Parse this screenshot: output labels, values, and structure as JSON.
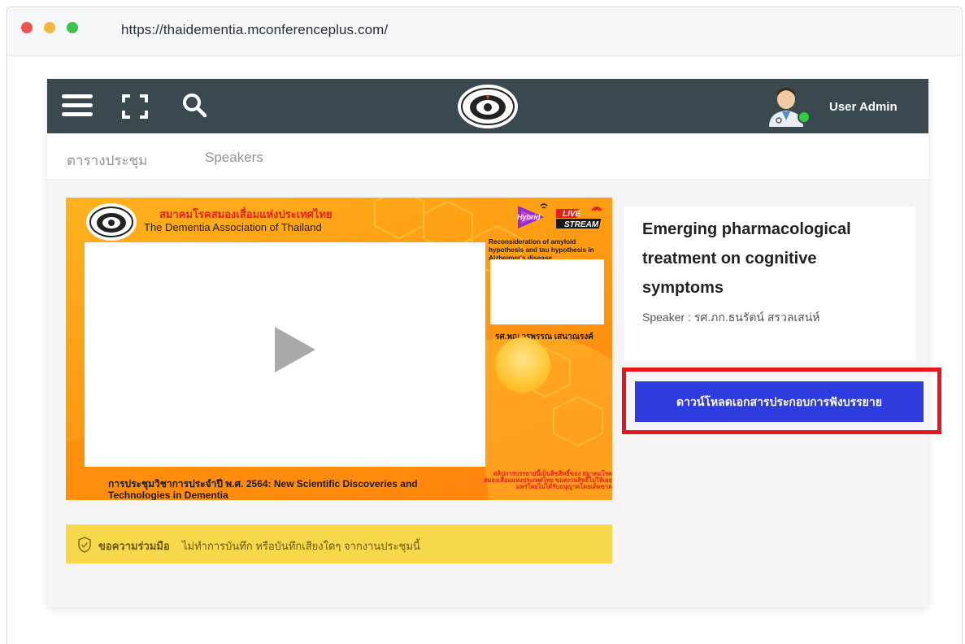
{
  "browser": {
    "url": "https://thaidementia.mconferenceplus.com/"
  },
  "header": {
    "menu_icon": "hamburger-icon",
    "fullscreen_icon": "expand-icon",
    "search_icon": "search-icon",
    "logo_icon": "association-logo",
    "avatar_icon": "doctor-avatar",
    "user_name": "User Admin",
    "status_color": "#2ecc40"
  },
  "nav": {
    "tabs": [
      {
        "label": "ตารางประชุม"
      },
      {
        "label": "Speakers"
      }
    ]
  },
  "video": {
    "association_th": "สมาคมโรคสมองเสื่อมแห่งประเทศไทย",
    "association_en": "The Dementia Association of Thailand",
    "hybrid_label": "Hybrid",
    "live_label_1": "LIVE",
    "live_label_2": "STREAM",
    "talk_title": "Reconsideration of amyloid hypothesis and tau hypothesis in Alzheimer's disease",
    "speaker_caption": "รศ.พญ.วรพรรณ เสนาณรงค์",
    "conference_title": "การประชุมวิชาการประจำปี พ.ศ. 2564: New Scientific Discoveries and Technologies in Dementia",
    "red_note": "คลิปการบรรยายนี้เป็นลิขสิทธิ์ของ สมาคมโรคสมองเสื่อมแห่งประเทศไทย ขอสงวนสิทธิ์ไม่ให้เผยแพร่โดยไม่ได้รับอนุญาตโดยเด็ดขาด",
    "play_icon": "play-icon"
  },
  "notice": {
    "bold": "ขอความร่วมมือ",
    "text": "ไม่ทำการบันทึก หรือบันทึกเสียงใดๆ จากงานประชุมนี้"
  },
  "session": {
    "title": "Emerging pharmacological treatment on cognitive symptoms",
    "speaker": "Speaker : รศ.ภก.ธนรัตน์ สรวลเสน่ห์"
  },
  "actions": {
    "download_label": "ดาวน์โหลดเอกสารประกอบการฟังบรรยาย",
    "button_color": "#2f3cdd",
    "highlight_color": "#e6161a"
  }
}
